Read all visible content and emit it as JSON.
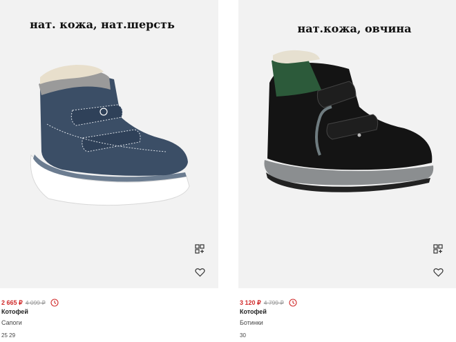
{
  "products": [
    {
      "overlay_text": "нат. кожа, нат.шерсть",
      "price": "2 665 ₽",
      "old_price": "4 099 ₽",
      "brand": "Котофей",
      "category": "Сапоги",
      "sizes": "25  29"
    },
    {
      "overlay_text": "нат.кожа, овчина",
      "price": "3 120 ₽",
      "old_price": "4 799 ₽",
      "brand": "Котофей",
      "category": "Ботинки",
      "sizes": "30"
    }
  ],
  "icons": {
    "compare": "compare-icon",
    "favorite": "heart-icon",
    "timer": "clock-icon"
  },
  "colors": {
    "price": "#d12b2b",
    "image_bg": "#f2f2f2"
  }
}
